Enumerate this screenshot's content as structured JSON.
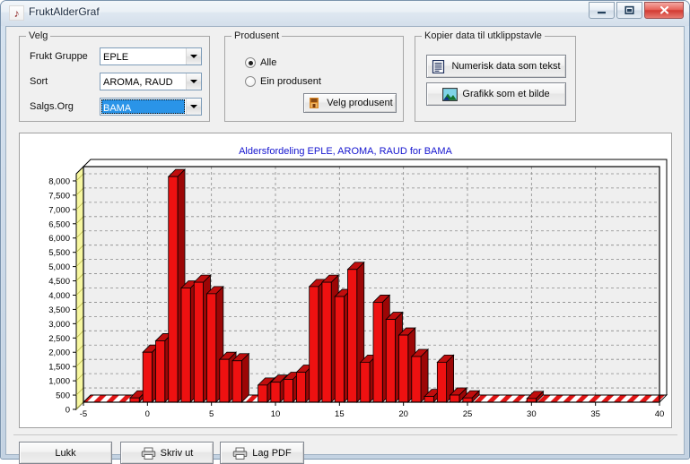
{
  "window": {
    "title": "FruktAlderGraf",
    "icon": "app-note-icon",
    "minimize_label": "–",
    "maximize_label": "❐",
    "close_label": "✕"
  },
  "velg_group": {
    "legend": "Velg",
    "fields": [
      {
        "label": "Frukt Gruppe",
        "value": "EPLE",
        "selected": false
      },
      {
        "label": "Sort",
        "value": "AROMA, RAUD",
        "selected": false
      },
      {
        "label": "Salgs.Org",
        "value": "BAMA",
        "selected": true
      }
    ]
  },
  "produsent_group": {
    "legend": "Produsent",
    "options": [
      {
        "label": "Alle",
        "checked": true
      },
      {
        "label": "Ein produsent",
        "checked": false
      }
    ],
    "button_label": "Velg produsent"
  },
  "kopier_group": {
    "legend": "Kopier data til utklippstavle",
    "buttons": [
      {
        "label": "Numerisk data som tekst",
        "icon": "text-document-icon"
      },
      {
        "label": "Grafikk som et bilde",
        "icon": "picture-image-icon"
      }
    ]
  },
  "footer": {
    "buttons": [
      {
        "label": "Lukk",
        "icon": "none"
      },
      {
        "label": "Skriv ut",
        "icon": "printer-icon"
      },
      {
        "label": "Lag PDF",
        "icon": "printer-icon"
      }
    ]
  },
  "chart_data": {
    "type": "bar",
    "title": "Aldersfordeling EPLE, AROMA, RAUD for BAMA",
    "xlabel": "",
    "ylabel": "",
    "xlim": [
      -5,
      40
    ],
    "ylim": [
      0,
      8250
    ],
    "xticks": [
      -5,
      0,
      5,
      10,
      15,
      20,
      25,
      30,
      35,
      40
    ],
    "yticks": [
      0,
      500,
      1000,
      1500,
      2000,
      2500,
      3000,
      3500,
      4000,
      4500,
      5000,
      5500,
      6000,
      6500,
      7000,
      7500,
      8000
    ],
    "ytick_labels": [
      "0",
      "500",
      "1,000",
      "1,500",
      "2,000",
      "2,500",
      "3,000",
      "3,500",
      "4,000",
      "4,500",
      "5,000",
      "5,500",
      "6,000",
      "6,500",
      "7,000",
      "7,500",
      "8,000"
    ],
    "grid": true,
    "legend": "none",
    "bar_color": "#ee1111",
    "bar_side_color": "#9c0606",
    "bar_top_color": "#c00d0d",
    "title_color": "#1414cf",
    "axis_band_color": "#f7f7a0",
    "categories": [
      -5,
      -4,
      -3,
      -2,
      -1,
      0,
      1,
      2,
      3,
      4,
      5,
      6,
      7,
      8,
      9,
      10,
      11,
      12,
      13,
      14,
      15,
      16,
      17,
      18,
      19,
      20,
      21,
      22,
      23,
      24,
      25,
      26,
      27,
      28,
      29,
      30,
      31,
      32,
      33,
      34,
      35,
      36,
      37,
      38,
      39,
      40
    ],
    "values": [
      0,
      0,
      0,
      0,
      150,
      1750,
      2150,
      7900,
      4000,
      4200,
      3800,
      1500,
      1450,
      0,
      600,
      700,
      800,
      1050,
      4050,
      4200,
      3700,
      4650,
      1400,
      3500,
      2900,
      2350,
      1600,
      200,
      1400,
      250,
      150,
      0,
      0,
      0,
      0,
      130,
      0,
      0,
      0,
      0,
      0,
      0,
      0,
      0,
      0,
      0
    ]
  }
}
